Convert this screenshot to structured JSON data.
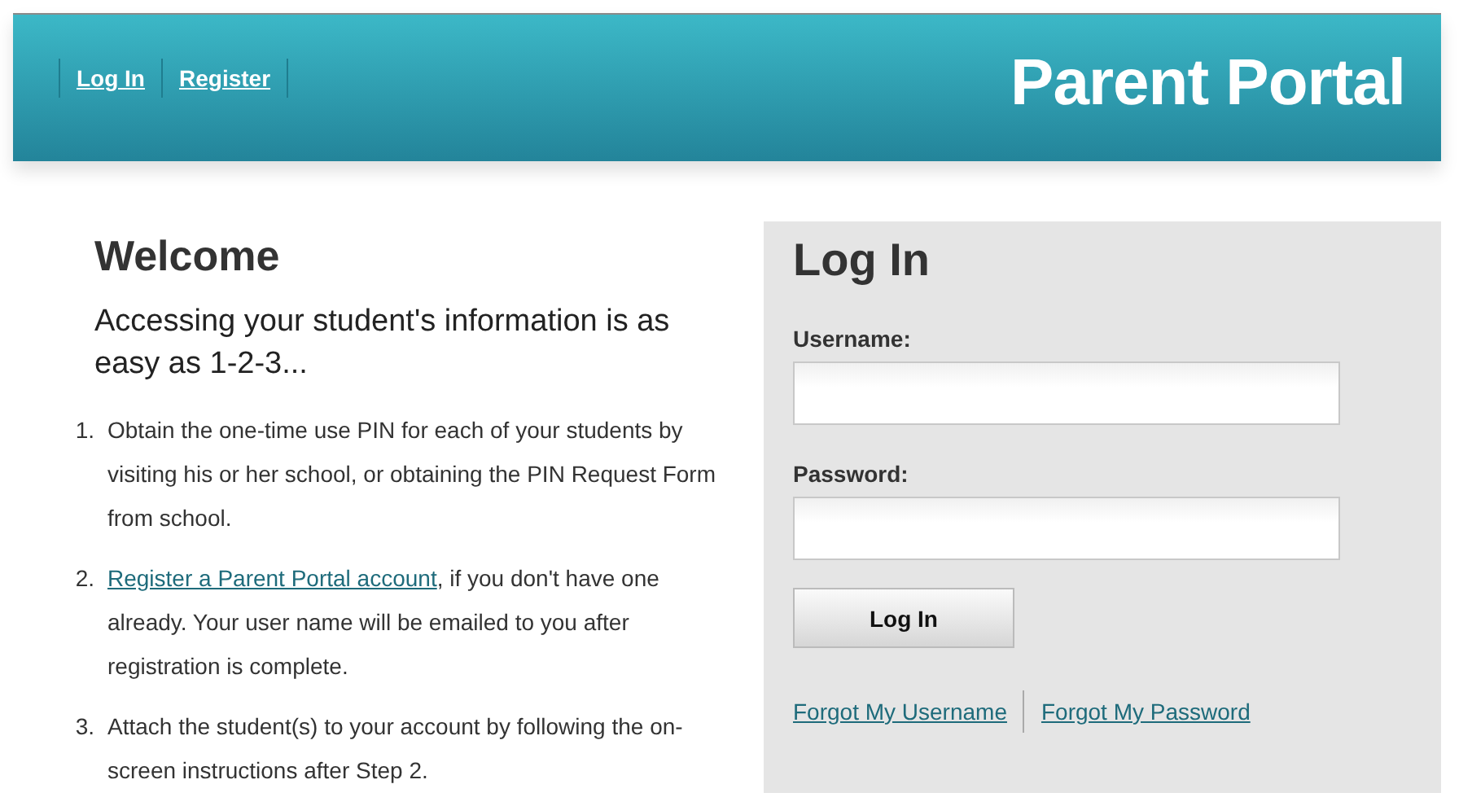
{
  "header": {
    "nav": [
      {
        "label": "Log In"
      },
      {
        "label": "Register"
      }
    ],
    "title": "Parent Portal"
  },
  "welcome": {
    "heading": "Welcome",
    "intro": "Accessing your student's information is as easy as 1-2-3...",
    "steps": [
      {
        "number": "1.",
        "parts": [
          {
            "kind": "text",
            "text": "Obtain the one-time use PIN for each of your students by visiting his or her school, or obtaining the PIN Request Form from school."
          }
        ]
      },
      {
        "number": "2.",
        "parts": [
          {
            "kind": "link",
            "text": "Register a Parent Portal account"
          },
          {
            "kind": "text",
            "text": ", if you don't have one already. Your user name will be emailed to you after registration is complete."
          }
        ]
      },
      {
        "number": "3.",
        "parts": [
          {
            "kind": "text",
            "text": "Attach the student(s) to your account by following the on-screen instructions after Step 2."
          }
        ]
      }
    ]
  },
  "login": {
    "heading": "Log In",
    "fields": [
      {
        "label": "Username:"
      },
      {
        "label": "Password:"
      }
    ],
    "button": "Log In",
    "links": [
      "Forgot My Username",
      "Forgot My Password"
    ]
  }
}
